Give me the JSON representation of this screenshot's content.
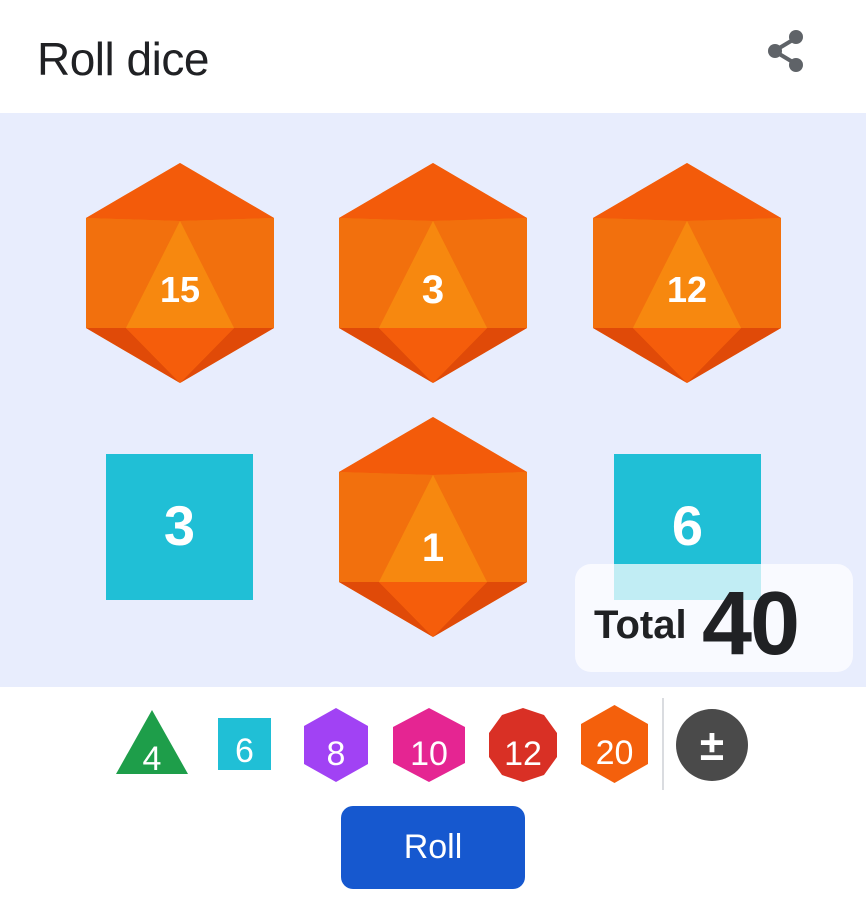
{
  "header": {
    "title": "Roll dice",
    "share_icon": "share-icon"
  },
  "tray": {
    "dice": [
      {
        "sides": 20,
        "value": "15",
        "color": "#f4600c"
      },
      {
        "sides": 20,
        "value": "3",
        "color": "#f4600c"
      },
      {
        "sides": 20,
        "value": "12",
        "color": "#f4600c"
      },
      {
        "sides": 6,
        "value": "3",
        "color": "#20bfd6"
      },
      {
        "sides": 20,
        "value": "1",
        "color": "#f4600c"
      },
      {
        "sides": 6,
        "value": "6",
        "color": "#20bfd6"
      }
    ],
    "total_label": "Total",
    "total_value": "40"
  },
  "picker": {
    "dice": [
      {
        "label": "4",
        "shape": "triangle",
        "color": "#1e9e4a"
      },
      {
        "label": "6",
        "shape": "square",
        "color": "#20bfd6"
      },
      {
        "label": "8",
        "shape": "hexagon",
        "color": "#a142f4"
      },
      {
        "label": "10",
        "shape": "hexagon",
        "color": "#e52592"
      },
      {
        "label": "12",
        "shape": "decagon",
        "color": "#d93025"
      },
      {
        "label": "20",
        "shape": "hexagon",
        "color": "#f4600c"
      }
    ],
    "custom_icon": "plus-minus-icon",
    "custom_label": "±"
  },
  "roll_button": {
    "label": "Roll",
    "color": "#1658cf"
  }
}
